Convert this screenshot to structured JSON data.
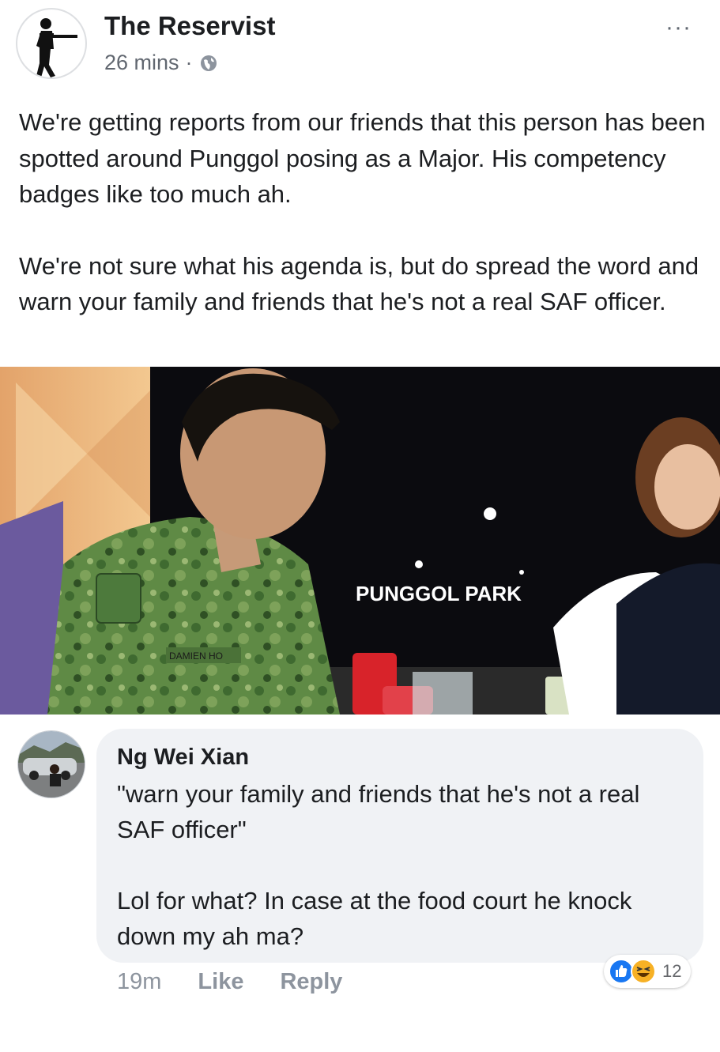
{
  "post": {
    "page_name": "The Reservist",
    "time": "26 mins",
    "separator": "·",
    "privacy_icon": "globe-icon",
    "more_icon": "more-dots-icon",
    "more_label": "···",
    "paragraphs": [
      "We're getting reports from our friends that this person has been spotted around Punggol posing as a Major. His competency badges like too much ah.",
      "We're not sure what his agenda is, but do spread the word and warn your family and friends that he's not a real SAF officer."
    ],
    "photo": {
      "sign_text": "PUNGGOL PARK",
      "name_tape": "DAMIEN HO"
    }
  },
  "comment": {
    "author": "Ng Wei Xian",
    "paragraphs": [
      "\"warn your family and friends that he's not a real SAF officer\"",
      "Lol for what? In case at the food court he knock down my ah ma?"
    ],
    "time": "19m",
    "like_label": "Like",
    "reply_label": "Reply",
    "reactions": {
      "icons": [
        "like-icon",
        "haha-icon"
      ],
      "count": "12",
      "like_color": "#1877f2",
      "haha_color": "#f7b125"
    }
  }
}
